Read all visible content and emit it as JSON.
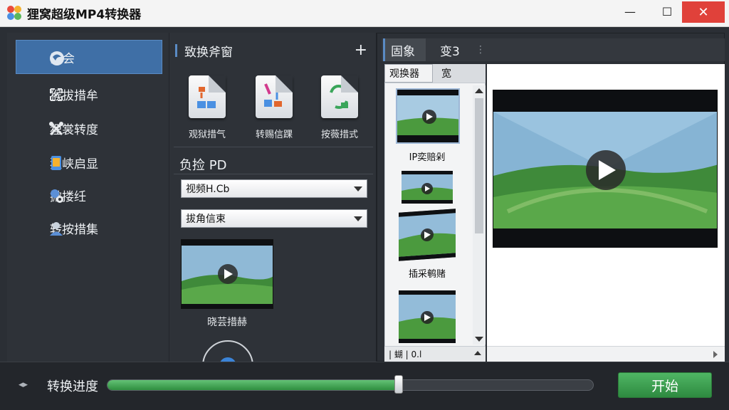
{
  "window": {
    "title": "狸窝超级MP4转换器",
    "minimize": "—",
    "maximize": "☐",
    "close": "✕"
  },
  "sidebar": {
    "items": [
      {
        "label": "蓝会",
        "icon": "swirl-icon",
        "active": true
      },
      {
        "label": "猴拔措牟",
        "icon": "crop-icon"
      },
      {
        "label": "狸裳转度",
        "icon": "tools-icon"
      },
      {
        "label": "狸峡启显",
        "icon": "device-icon"
      },
      {
        "label": "掀搂纴",
        "icon": "user-settings-icon"
      },
      {
        "label": "转按措集",
        "icon": "user-icon"
      }
    ]
  },
  "middle": {
    "title": "致换斧窗",
    "add_label": "+",
    "tools": [
      {
        "label": "观狱措气",
        "icon": "convert-doc-icon"
      },
      {
        "label": "转赐信踝",
        "icon": "edit-doc-icon"
      },
      {
        "label": "按薇措式",
        "icon": "format-doc-icon"
      }
    ],
    "section_title": "负捡 PD",
    "select1_value": "视频H.Cb",
    "select2_value": "拔角信束",
    "preview_label": "晓芸措赫"
  },
  "right": {
    "tabs": [
      {
        "label": "固象",
        "active": true
      },
      {
        "label": "变3"
      }
    ],
    "more": "⋮",
    "subtabs": [
      {
        "label": "观换器",
        "active": true
      },
      {
        "label": "宽"
      }
    ],
    "thumbs": [
      {
        "caption": "IP奕赔剁"
      },
      {
        "caption": ""
      },
      {
        "caption": "插采鹌赌"
      },
      {
        "caption": ""
      }
    ],
    "list_footer": "| 蝴 | 0.l"
  },
  "bottom": {
    "nav": "◂▸",
    "progress_label": "转换进度",
    "progress_value": 0.6,
    "start_label": "开始"
  },
  "colors": {
    "accent": "#3f6fa6",
    "progress": "#4caf50",
    "start": "#3ea352",
    "close": "#e0413a"
  }
}
